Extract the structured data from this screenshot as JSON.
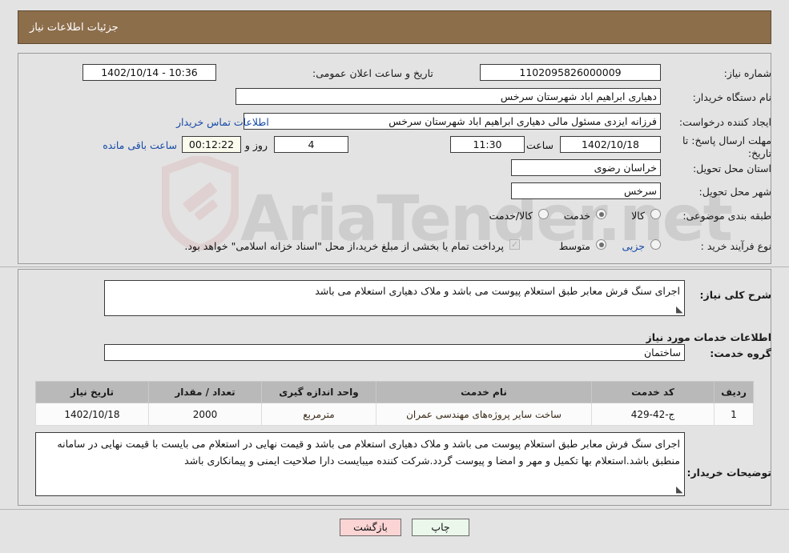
{
  "header": {
    "title": "جزئیات اطلاعات نیاز"
  },
  "form": {
    "need_number_label": "شماره نیاز:",
    "need_number_value": "1102095826000009",
    "announce_label": "تاریخ و ساعت اعلان عمومی:",
    "announce_value": "10:36 - 1402/10/14",
    "buyer_org_label": "نام دستگاه خریدار:",
    "buyer_org_value": "دهیاری ابراهیم اباد شهرستان سرخس",
    "requester_label": "ایجاد کننده درخواست:",
    "requester_value": "فرزانه ایزدی مسئول مالی دهیاری ابراهیم اباد شهرستان سرخس",
    "contact_link": "اطلاعات تماس خریدار",
    "deadline_label": "مهلت ارسال پاسخ: تا تاریخ:",
    "deadline_date": "1402/10/18",
    "deadline_hour_label": "ساعت",
    "deadline_hour": "11:30",
    "remaining_days": "4",
    "remaining_days_label": "روز و",
    "remaining_time": "00:12:22",
    "remaining_time_label": "ساعت باقی مانده",
    "province_label": "استان محل تحویل:",
    "province_value": "خراسان رضوی",
    "city_label": "شهر محل تحویل:",
    "city_value": "سرخس",
    "category_label": "طبقه بندی موضوعی:",
    "category_options": [
      {
        "label": "کالا",
        "selected": false
      },
      {
        "label": "خدمت",
        "selected": true
      },
      {
        "label": "کالا/خدمت",
        "selected": false
      }
    ],
    "process_label": "نوع فرآیند خرید :",
    "process_options": [
      {
        "label": "جزیی",
        "selected": false
      },
      {
        "label": "متوسط",
        "selected": true
      }
    ],
    "treasury_checkbox_checked": true,
    "treasury_text": "پرداخت تمام یا بخشی از مبلغ خرید،از محل \"اسناد خزانه اسلامی\" خواهد بود."
  },
  "detail": {
    "summary_label": "شرح کلی نیاز:",
    "summary_value": "اجرای سنگ فرش معابر  طبق استعلام پیوست می باشد و ملاک دهیاری استعلام می باشد",
    "services_heading": "اطلاعات خدمات مورد نیاز",
    "service_group_label": "گروه خدمت:",
    "service_group_value": "ساختمان",
    "buyer_notes_label": "توضیحات خریدار:",
    "buyer_notes_value": "اجرای سنگ فرش معابر  طبق استعلام پیوست می باشد و ملاک دهیاری استعلام می باشد و قیمت نهایی در استعلام می بایست با قیمت نهایی در سامانه منطبق باشد.استعلام بها تکمیل و مهر و امضا و پیوست گردد.شرکت کننده میبایست دارا صلاحیت ایمنی و پیمانکاری باشد"
  },
  "table": {
    "columns": [
      "ردیف",
      "کد خدمت",
      "نام خدمت",
      "واحد اندازه گیری",
      "تعداد / مقدار",
      "تاریخ نیاز"
    ],
    "rows": [
      {
        "index": "1",
        "code": "ج-42-429",
        "name": "ساخت سایر پروژه‌های مهندسی عمران",
        "unit": "مترمربع",
        "quantity": "2000",
        "date": "1402/10/18"
      }
    ]
  },
  "footer": {
    "back_label": "بازگشت",
    "print_label": "چاپ"
  },
  "watermark": {
    "text": "AriaTender.net"
  },
  "colors": {
    "header_bg": "#8d6e4b",
    "page_bg": "#e3e3e3",
    "link": "#1649a6",
    "table_header_bg": "#b9b9b9",
    "back_btn_bg": "#fbd4d4",
    "print_btn_bg": "#eaf7ea"
  }
}
